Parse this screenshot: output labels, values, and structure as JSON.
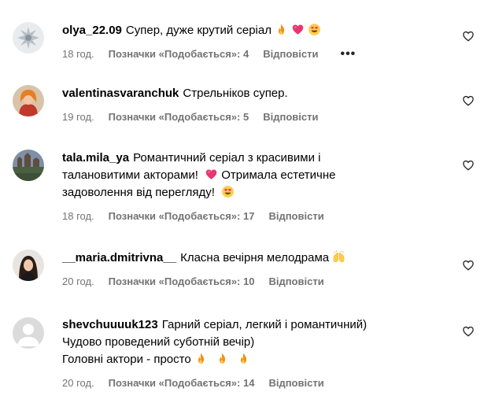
{
  "comments": [
    {
      "username": "olya_22.09",
      "text": "Супер, дуже крутий серіал",
      "emojis": [
        "fire",
        "heart",
        "heart-eyes"
      ],
      "time": "18 год.",
      "likes": "Позначки «Подобається»: 4",
      "reply": "Відповісти",
      "more": "•••"
    },
    {
      "username": "valentinasvaranchuk",
      "text": "Стрельніков супер.",
      "emojis": [],
      "time": "19 год.",
      "likes": "Позначки «Подобається»: 5",
      "reply": "Відповісти"
    },
    {
      "username": "tala.mila_ya",
      "text": "Романтичний серіал з красивими і\nталановитими акторами! ",
      "text2": " Отримала естетичне\nзадоволення від перегляду! ",
      "emojis": [
        "heart",
        "heart-eyes"
      ],
      "time": "18 год.",
      "likes": "Позначки «Подобається»: 17",
      "reply": "Відповісти"
    },
    {
      "username": "__maria.dmitrivna__",
      "text": "Класна вечірня мелодрама",
      "emojis": [
        "raised-hands"
      ],
      "time": "20 год.",
      "likes": "Позначки «Подобається»: 10",
      "reply": "Відповісти"
    },
    {
      "username": "shevchuuuuk123",
      "text": "Гарний серіал, легкий і романтичний)\nЧудово проведений суботній вечір)\nГоловні актори - просто",
      "emojis": [
        "fire",
        "fire",
        "fire"
      ],
      "time": "20 год.",
      "likes": "Позначки «Подобається»: 14",
      "reply": "Відповісти"
    }
  ],
  "colors": {
    "meta": "#737373",
    "fire": "#f4900c",
    "heart": "#e8366f"
  }
}
